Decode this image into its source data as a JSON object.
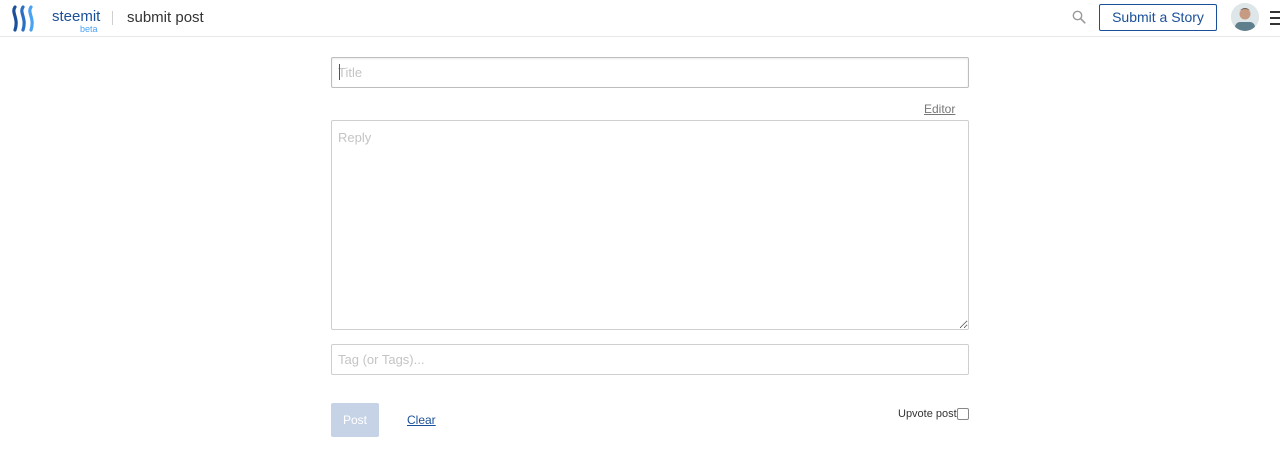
{
  "header": {
    "brand": "steemit",
    "brand_badge": "beta",
    "page_title": "submit post",
    "submit_story_label": "Submit a Story",
    "icons": {
      "logo": "steemit-logo",
      "search": "search-icon",
      "menu": "hamburger-menu-icon"
    },
    "accent_color": "#1a5099"
  },
  "form": {
    "title_placeholder": "Title",
    "editor_toggle_label": "Editor",
    "body_placeholder": "Reply",
    "tags_placeholder": "Tag (or Tags)...",
    "post_button_label": "Post",
    "clear_label": "Clear",
    "upvote_label": "Upvote post",
    "upvote_checked": false
  }
}
